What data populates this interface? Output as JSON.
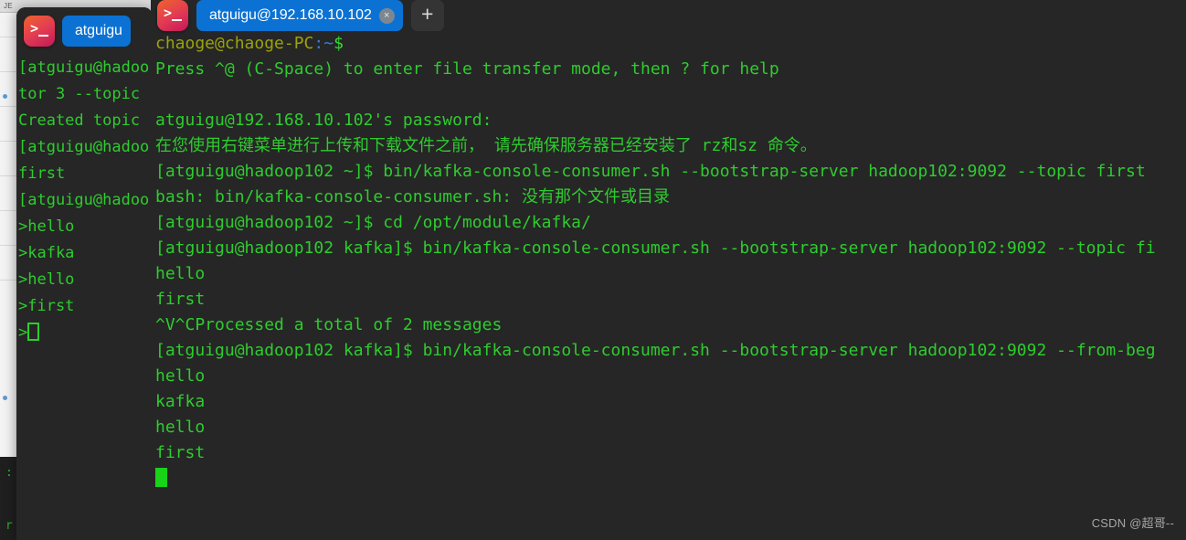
{
  "background_window": {
    "label": "JE",
    "blips": 3
  },
  "back_terminal": {
    "lines": [
      ":",
      "r"
    ]
  },
  "left_window": {
    "icon": "terminal-app-icon",
    "tab": {
      "title": "atguigu",
      "close_glyph": "×"
    },
    "lines": [
      "[atguigu@hadoo",
      "tor 3 --topic ",
      "Created topic ",
      "[atguigu@hadoo",
      "first",
      "[atguigu@hadoo",
      ">hello",
      ">kafka",
      ">hello",
      ">first",
      ">"
    ]
  },
  "right_window": {
    "icon": "terminal-app-icon",
    "tab": {
      "title": "atguigu@192.168.10.102",
      "close_glyph": "×"
    },
    "new_tab_glyph": "+",
    "prompt_local": {
      "user_host": "chaoge@chaoge-PC",
      "path": ":~",
      "sigil": "$"
    },
    "lines": [
      "Press ^@ (C-Space) to enter file transfer mode, then ? for help",
      "",
      "atguigu@192.168.10.102's password:",
      "在您使用右键菜单进行上传和下载文件之前， 请先确保服务器已经安装了 rz和sz 命令。",
      "[atguigu@hadoop102 ~]$ bin/kafka-console-consumer.sh --bootstrap-server hadoop102:9092 --topic first",
      "bash: bin/kafka-console-consumer.sh: 没有那个文件或目录",
      "[atguigu@hadoop102 ~]$ cd /opt/module/kafka/",
      "[atguigu@hadoop102 kafka]$ bin/kafka-console-consumer.sh --bootstrap-server hadoop102:9092 --topic fi",
      "hello",
      "first",
      "^V^CProcessed a total of 2 messages",
      "[atguigu@hadoop102 kafka]$ bin/kafka-console-consumer.sh --bootstrap-server hadoop102:9092 --from-beg",
      "hello",
      "kafka",
      "hello",
      "first"
    ]
  },
  "watermark": {
    "text": "CSDN @超哥--"
  },
  "colors": {
    "terminal_bg": "#262626",
    "text_green": "#2ecc2e",
    "prompt_olive": "#9aa30b",
    "prompt_blue": "#2f7fd0",
    "tab_active": "#0b72d4",
    "cursor": "#18d318"
  }
}
